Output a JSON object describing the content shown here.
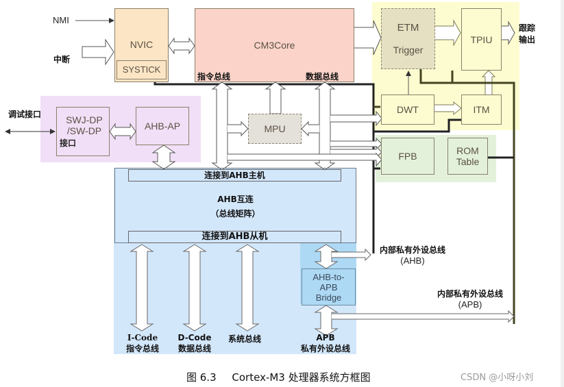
{
  "diagram": {
    "inputs": {
      "nmi": "NMI",
      "interrupt": "中断",
      "debug_port": "调试接口",
      "trace_output_line1": "跟踪",
      "trace_output_line2": "输出"
    },
    "blocks": {
      "nvic": "NVIC",
      "systick": "SYSTICK",
      "cm3core": "CM3Core",
      "instr_bus": "指令总线",
      "data_bus": "数据总线",
      "etm": "ETM",
      "trigger": "Trigger",
      "tpiu": "TPIU",
      "dwt": "DWT",
      "itm": "ITM",
      "mpu": "MPU",
      "swj_dp_line1": "SWJ-DP",
      "swj_dp_line2": "/SW-DP",
      "swj_dp_line3": "接口",
      "ahb_ap": "AHB-AP",
      "fpb": "FPB",
      "rom_table_line1": "ROM",
      "rom_table_line2": "Table",
      "ahb_master": "连接到AHB主机",
      "ahb_interconnect_line1": "AHB互连",
      "ahb_interconnect_line2": "（总线矩阵）",
      "ahb_slave": "连接到AHB从机",
      "bridge_line1": "AHB-to-",
      "bridge_line2": "APB",
      "bridge_line3": "Bridge"
    },
    "buses": {
      "icode_line1": "I-Code",
      "icode_line2": "指令总线",
      "dcode_line1": "D-Code",
      "dcode_line2": "数据总线",
      "system_bus": "系统总线",
      "apb_line1": "APB",
      "apb_line2": "私有外设总线",
      "ppb_ahb_line1": "内部私有外设总线",
      "ppb_ahb_line2": "(AHB)",
      "ppb_apb_line1": "内部私有外设总线",
      "ppb_apb_line2": "(APB)"
    },
    "colors": {
      "nvic_fill": "#fbe5c4",
      "core_fill": "#fbd3c8",
      "debug_region": "#fdfcd0",
      "etm_fill": "#e5e0c2",
      "mpu_fill": "#e4e1da",
      "dap_region": "#f1dff7",
      "fpb_region": "#e3f1da",
      "ahb_region": "#d3e7fb",
      "bridge_fill": "#aed9f5"
    }
  },
  "caption": {
    "figure": "图 6.3",
    "title": "Cortex-M3 处理器系统方框图",
    "watermark": "CSDN @小呀小刘"
  }
}
